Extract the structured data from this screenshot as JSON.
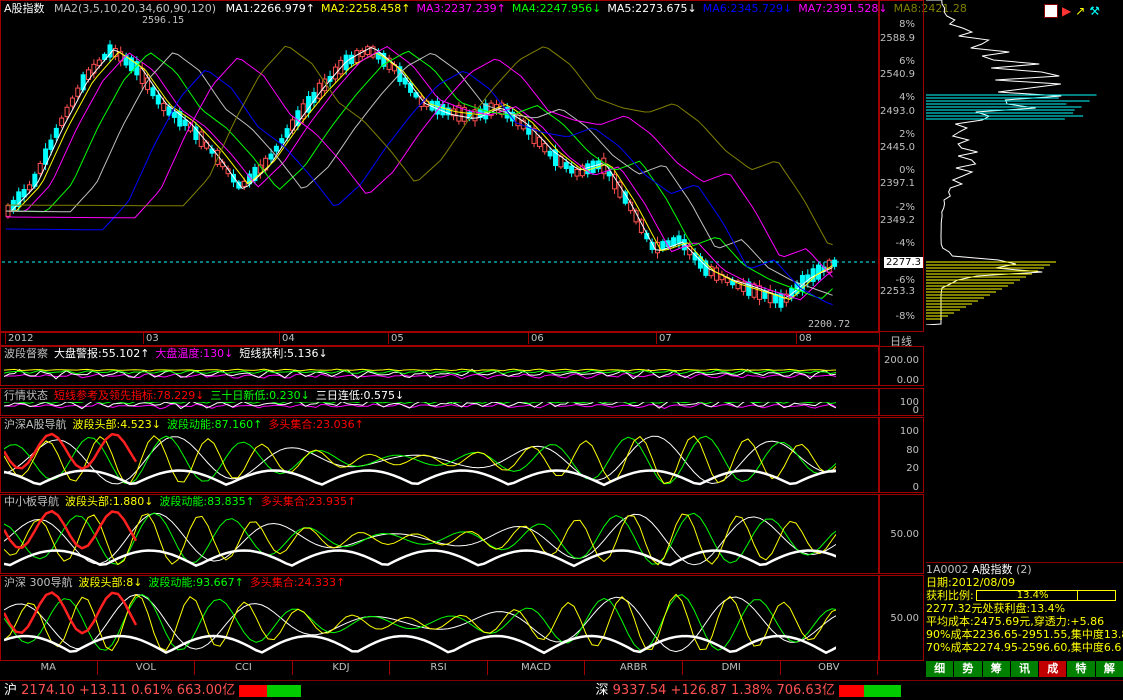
{
  "main": {
    "title": "A股指数",
    "ma_params": "MA2(3,5,10,20,34,60,90,120)",
    "ma_values": [
      {
        "label": "MA1:2266.979↑",
        "color": "#ffffff"
      },
      {
        "label": "MA2:2258.458↑",
        "color": "#ffff00"
      },
      {
        "label": "MA3:2237.239↑",
        "color": "#ff00ff"
      },
      {
        "label": "MA4:2247.956↓",
        "color": "#00ff00"
      },
      {
        "label": "MA5:2273.675↓",
        "color": "#ffffff"
      },
      {
        "label": "MA6:2345.729↓",
        "color": "#0000ff"
      },
      {
        "label": "MA7:2391.528↓",
        "color": "#ff00ff"
      },
      {
        "label": "MA8:2421.28",
        "color": "#808000"
      }
    ],
    "high_label": "2596.15",
    "low_label": "2200.72",
    "current_label": "2277.3",
    "price_axis": [
      "2588.9",
      "2540.9",
      "2493.0",
      "2445.0",
      "2397.1",
      "2349.2",
      "2253.3"
    ],
    "pct_axis": [
      "8%",
      "6%",
      "4%",
      "2%",
      "0%",
      "-2%",
      "-4%",
      "-6%",
      "-8%"
    ],
    "date_axis": [
      "2012",
      "03",
      "04",
      "05",
      "06",
      "07",
      "08"
    ],
    "period": "日线"
  },
  "panels": [
    {
      "name": "波段督察",
      "items": [
        {
          "t": "大盘警报:55.102↑",
          "c": "#ffffff"
        },
        {
          "t": "大盘温度:130↓",
          "c": "#ff00ff"
        },
        {
          "t": "短线获利:5.136↓",
          "c": "#ffffff"
        }
      ],
      "axis": [
        "200.00",
        "0.00"
      ]
    },
    {
      "name": "行情状态",
      "items": [
        {
          "t": "短线参考及领先指标:78.229↓",
          "c": "#ff0000"
        },
        {
          "t": "三十日新低:0.230↓",
          "c": "#00ff00"
        },
        {
          "t": "三日连低:0.575↓",
          "c": "#ffffff"
        }
      ],
      "axis": [
        "100",
        "0"
      ]
    },
    {
      "name": "沪深A股导航",
      "items": [
        {
          "t": "波段头部:4.523↓",
          "c": "#ffff00"
        },
        {
          "t": "波段动能:87.160↑",
          "c": "#00ff00"
        },
        {
          "t": "多头集合:23.036↑",
          "c": "#ff0000"
        }
      ],
      "axis": [
        "100",
        "80",
        "20",
        "0"
      ]
    },
    {
      "name": "中小板导航",
      "items": [
        {
          "t": "波段头部:1.880↓",
          "c": "#ffff00"
        },
        {
          "t": "波段动能:83.835↑",
          "c": "#00ff00"
        },
        {
          "t": "多头集合:23.935↑",
          "c": "#ff0000"
        }
      ],
      "axis": [
        "50.00"
      ]
    },
    {
      "name": "沪深 300导航",
      "items": [
        {
          "t": "波段头部:8↓",
          "c": "#ffff00"
        },
        {
          "t": "波段动能:93.667↑",
          "c": "#00ff00"
        },
        {
          "t": "多头集合:24.333↑",
          "c": "#ff0000"
        }
      ],
      "axis": [
        "50.00"
      ]
    }
  ],
  "indicator_tabs": [
    "MA",
    "VOL",
    "CCI",
    "KDJ",
    "RSI",
    "MACD",
    "ARBR",
    "DMI",
    "OBV"
  ],
  "right_panel": {
    "code": "1A0002",
    "name": "A股指数",
    "num": "(2)",
    "date": "日期:2012/08/09",
    "profit_label": "获利比例:",
    "profit_value": "13.4%",
    "line1": "2277.32元处获利盘:13.4%",
    "line2": "平均成本:2475.69元,穿透力:+5.86",
    "line3": "90%成本2236.65-2951.55,集中度13.8",
    "line4": "70%成本2274.95-2596.60,集中度6.6",
    "tabs": [
      "细",
      "势",
      "筹",
      "讯",
      "成",
      "特",
      "解"
    ],
    "selected_tab": "成"
  },
  "status": {
    "sh_name": "沪",
    "sh_text": "2174.10 +13.11 0.61% 663.00亿",
    "sz_name": "深",
    "sz_text": "9337.54 +126.87 1.38% 706.63亿"
  }
}
